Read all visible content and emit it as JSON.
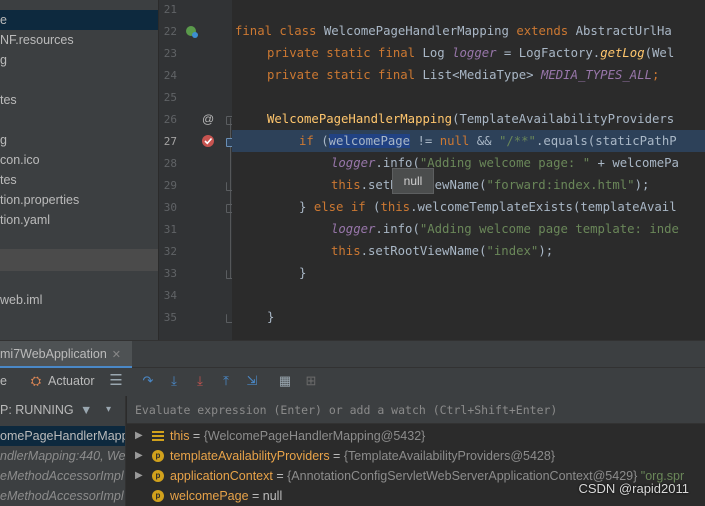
{
  "project_tree": {
    "items": [
      {
        "label": "e",
        "selected": true
      },
      {
        "label": "NF.resources"
      },
      {
        "label": "g"
      },
      {
        "label": ""
      },
      {
        "label": "tes"
      },
      {
        "label": ""
      },
      {
        "label": "g"
      },
      {
        "label": "con.ico"
      },
      {
        "label": "tes"
      },
      {
        "label": "tion.properties"
      },
      {
        "label": "tion.yaml"
      },
      {
        "label": ""
      },
      {
        "label": ""
      },
      {
        "label": ""
      },
      {
        "label": "web.iml"
      }
    ]
  },
  "gutter": {
    "line_numbers": [
      "21",
      "22",
      "23",
      "24",
      "25",
      "26",
      "27",
      "28",
      "29",
      "30",
      "31",
      "32",
      "33",
      "34",
      "35"
    ],
    "current_line": "27",
    "marker_26": "@"
  },
  "editor": {
    "line_22": {
      "kw1": "final class ",
      "cls": "WelcomePageHandlerMapping ",
      "kw2": "extends ",
      "cls2": "AbstractUrlHa"
    },
    "line_23": {
      "kw": "private static final ",
      "type": "Log ",
      "fld": "logger",
      "op": " = LogFactory.",
      "mth": "getLog",
      "rest": "(Wel"
    },
    "line_24": {
      "kw": "private static final ",
      "type": "List<MediaType> ",
      "fld": "MEDIA_TYPES_ALL",
      "rest": ";"
    },
    "line_26": {
      "mth": "WelcomePageHandlerMapping",
      "rest": "(TemplateAvailabilityProviders"
    },
    "line_27": {
      "kw": "if ",
      "p1": "(",
      "sel": "welcomePage",
      "op": " != ",
      "kw2": "null",
      "op2": " && ",
      "str": "\"/**\"",
      "rest": ".equals(staticPathP"
    },
    "line_28": {
      "fld": "logger",
      "rest": ".info(",
      "str": "\"Adding welcome page: \"",
      "rest2": " + welcomePa"
    },
    "line_29": {
      "kw": "this",
      "rest": ".setRootViewName(",
      "str": "\"forward:index.html\"",
      "rest2": ");"
    },
    "line_30": {
      "p": "} ",
      "kw": "else if ",
      "p2": "(",
      "kw2": "this",
      "rest": ".welcomeTemplateExists(templateAvail"
    },
    "line_31": {
      "fld": "logger",
      "rest": ".info(",
      "str": "\"Adding welcome page template: inde"
    },
    "line_32": {
      "kw": "this",
      "rest": ".setRootViewName(",
      "str": "\"index\"",
      "rest2": ");"
    },
    "line_33": {
      "p": "}"
    },
    "line_35": {
      "p": "}"
    },
    "tooltip": "null"
  },
  "debug": {
    "tab_label": "mi7WebApplication",
    "toolbar": {
      "left_label": "e",
      "actuator_label": "Actuator"
    },
    "frames_header": "P: RUNNING",
    "frames": [
      {
        "label": "omePageHandlerMappi",
        "selected": true
      },
      {
        "label": "ndlerMapping:440, We"
      },
      {
        "label": "eMethodAccessorImpl"
      },
      {
        "label": "eMethodAccessorImpl"
      }
    ],
    "eval_placeholder": "Evaluate expression (Enter) or add a watch (Ctrl+Shift+Enter)",
    "variables": [
      {
        "name": "this",
        "eq": " = ",
        "value": "{WelcomePageHandlerMapping@5432}",
        "icon": "fields-icon"
      },
      {
        "name": "templateAvailabilityProviders",
        "eq": " = ",
        "value": "{TemplateAvailabilityProviders@5428}",
        "icon": "p"
      },
      {
        "name": "applicationContext",
        "eq": " = ",
        "value": "{AnnotationConfigServletWebServerApplicationContext@5429} ",
        "extra": "\"org.spr",
        "icon": "p"
      },
      {
        "name": "welcomePage",
        "eq": " = ",
        "value": "null",
        "icon": "p"
      }
    ]
  },
  "watermark": "CSDN @rapid2011",
  "colors": {
    "accent": "#4a88c7",
    "keyword": "#cc7832",
    "string": "#6a8759",
    "field": "#9876aa",
    "method": "#ffc66d"
  }
}
